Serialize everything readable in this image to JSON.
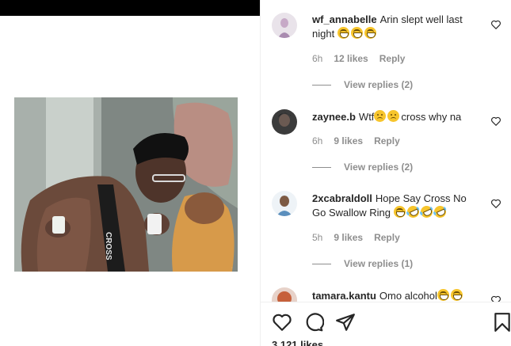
{
  "comments": [
    {
      "username": "wf_annabelle",
      "text": "Arin slept well last night",
      "emojis": [
        "grin",
        "grin",
        "grin"
      ],
      "time": "6h",
      "likes": "12 likes",
      "reply_label": "Reply",
      "view_replies": "View replies (2)"
    },
    {
      "username": "zaynee.b",
      "text_before": "Wtf",
      "emojis_mid": [
        "sad",
        "sad"
      ],
      "text_after": "cross why na",
      "time": "6h",
      "likes": "9 likes",
      "reply_label": "Reply",
      "view_replies": "View replies (2)"
    },
    {
      "username": "2xcabraldoll",
      "text": "Hope Say Cross No Go Swallow Ring",
      "emojis": [
        "grin",
        "rofl",
        "rofl",
        "rofl"
      ],
      "time": "5h",
      "likes": "9 likes",
      "reply_label": "Reply",
      "view_replies": "View replies (1)"
    },
    {
      "username": "tamara.kantu",
      "text": "Omo alcohol",
      "emojis": [
        "grin",
        "grin"
      ]
    }
  ],
  "video": {
    "shirt_text": "CROSS"
  },
  "actions": {
    "like_icon": "heart-icon",
    "comment_icon": "comment-icon",
    "share_icon": "share-icon",
    "save_icon": "bookmark-icon"
  },
  "likes_count": "3,121 likes",
  "colors": {
    "text": "#262626",
    "muted": "#8e8e8e",
    "divider": "#efefef",
    "emoji": "#f7c52c"
  }
}
